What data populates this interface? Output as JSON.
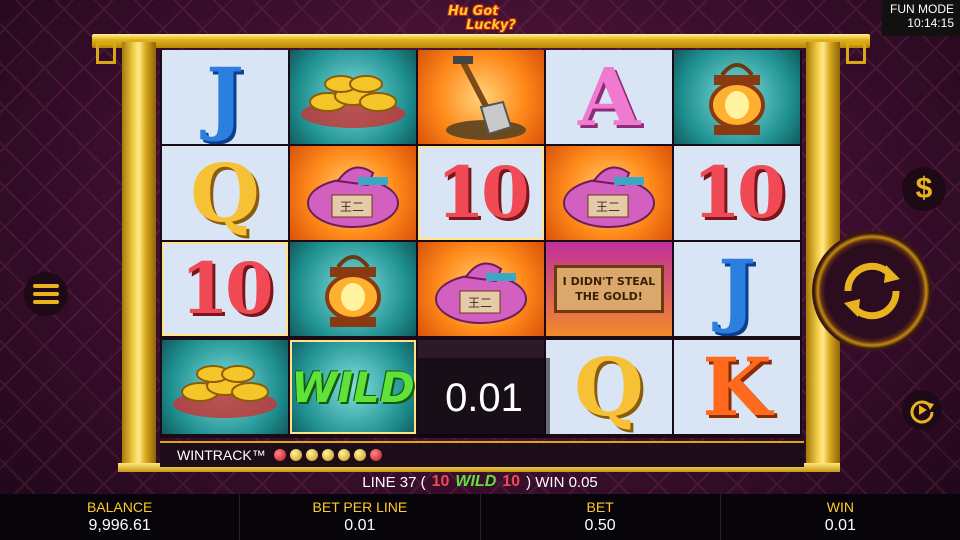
{
  "game": {
    "logo_line1": "Hu Got",
    "logo_line2": "Lucky?"
  },
  "status": {
    "mode": "FUN MODE",
    "time": "10:14:15"
  },
  "reels": [
    [
      "J",
      "gold-ingots",
      "Q",
      "10",
      "gold-ingots"
    ],
    [
      "gold-ingots",
      "money-bag",
      "lantern",
      "wild"
    ],
    [
      "shovel",
      "10",
      "money-bag",
      "wild-overlay"
    ],
    [
      "A",
      "money-bag",
      "sign",
      "Q"
    ],
    [
      "lantern",
      "10",
      "J",
      "K"
    ]
  ],
  "symbols": {
    "J": "J",
    "Q": "Q",
    "A": "A",
    "K": "K",
    "ten": "10",
    "wild": "WILD"
  },
  "sign": {
    "line1": "I DIDN'T STEAL",
    "line2": "THE GOLD!"
  },
  "money_bag_label": "王二",
  "win_overlay": "0.01",
  "wintrack": {
    "label": "WINTRACK™",
    "dots": [
      "red",
      "gold",
      "gold",
      "gold",
      "gold",
      "gold",
      "red"
    ]
  },
  "line_info": {
    "prefix": "LINE 37 (",
    "sym1": "10",
    "sym2": "WILD",
    "sym3": "10",
    "suffix": ") WIN 0.05"
  },
  "bottom_bar": {
    "balance_label": "BALANCE",
    "balance_value": "9,996.61",
    "bet_per_line_label": "BET PER LINE",
    "bet_per_line_value": "0.01",
    "bet_label": "BET",
    "bet_value": "0.50",
    "win_label": "WIN",
    "win_value": "0.01"
  },
  "buttons": {
    "dollar": "$"
  },
  "colors": {
    "gold": "#ffcb2e",
    "wild_green": "#5fe23a",
    "ten_red": "#ef4a55"
  }
}
